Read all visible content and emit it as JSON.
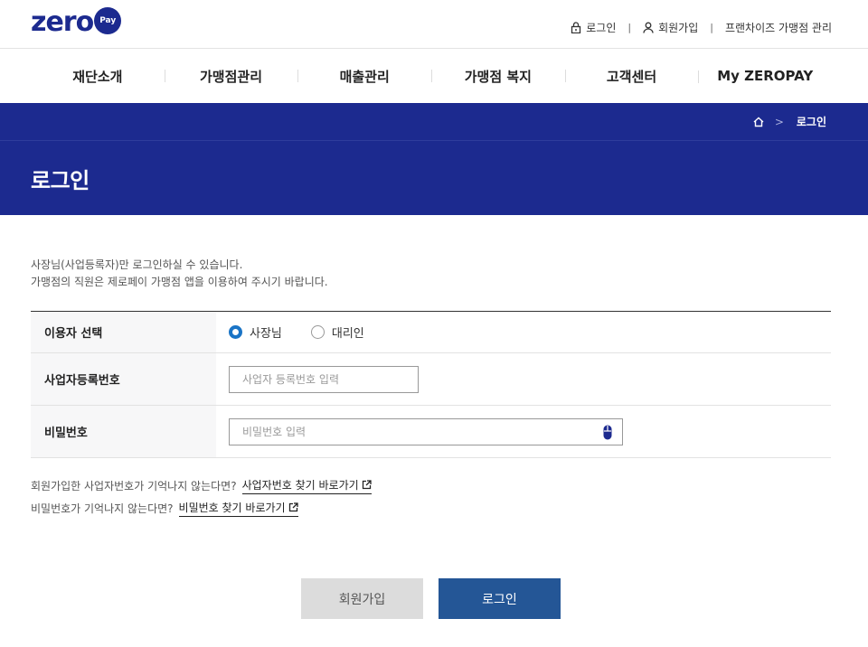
{
  "logo": {
    "text": "zero",
    "badge": "Pay"
  },
  "utility_nav": {
    "login": "로그인",
    "signup": "회원가입",
    "franchise": "프랜차이즈 가맹점 관리",
    "separator": "|"
  },
  "gnb": [
    "재단소개",
    "가맹점관리",
    "매출관리",
    "가맹점 복지",
    "고객센터",
    "My ZEROPAY"
  ],
  "breadcrumb": {
    "current": "로그인",
    "separator": ">"
  },
  "page_title": "로그인",
  "notice": [
    "사장님(사업등록자)만 로그인하실 수 있습니다.",
    "가맹점의 직원은 제로페이 가맹점 앱을 이용하여 주시기 바랍니다."
  ],
  "form": {
    "user_type": {
      "label": "이용자 선택",
      "options": [
        "사장님",
        "대리인"
      ],
      "selected": "사장님"
    },
    "business_number": {
      "label": "사업자등록번호",
      "placeholder": "사업자 등록번호 입력",
      "value": ""
    },
    "password": {
      "label": "비밀번호",
      "placeholder": "비밀번호 입력",
      "value": ""
    }
  },
  "help": {
    "business_number_text": "회원가입한 사업자번호가 기억나지 않는다면?",
    "business_number_link": "사업자번호 찾기 바로가기",
    "password_text": "비밀번호가 기억나지 않는다면?",
    "password_link": "비밀번호 찾기 바로가기"
  },
  "buttons": {
    "signup": "회원가입",
    "login": "로그인"
  },
  "colors": {
    "brand": "#1c2a8f",
    "radio_selected": "#1a74c6",
    "login_button": "#245696",
    "signup_button": "#dcdcdc"
  }
}
